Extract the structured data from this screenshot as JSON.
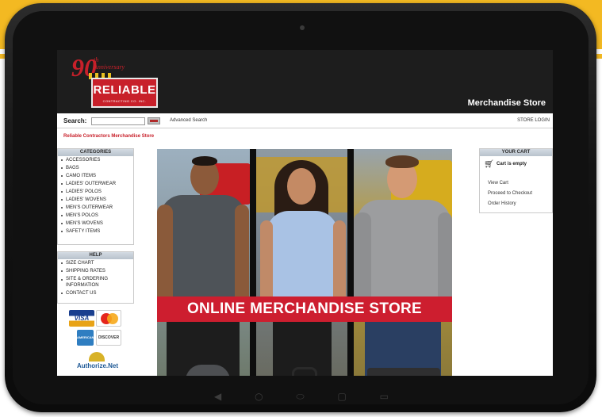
{
  "header": {
    "logo_90": "90",
    "logo_anniversary": "th Anniversary",
    "logo_brand": "RELIABLE",
    "logo_subtitle": "CONTRACTING CO. INC.",
    "store_title": "Merchandise Store"
  },
  "search": {
    "label": "Search:",
    "value": "",
    "placeholder": "",
    "advanced_label": "Advanced Search",
    "store_login_label": "STORE LOGIN"
  },
  "breadcrumb": "Reliable Contractors Merchandise Store",
  "categories": {
    "title": "CATEGORIES",
    "items": [
      "ACCESSORIES",
      "BAGS",
      "CAMO ITEMS",
      "LADIES' OUTERWEAR",
      "LADIES' POLOS",
      "LADIES' WOVENS",
      "MEN'S OUTERWEAR",
      "MEN'S POLOS",
      "MEN'S WOVENS",
      "SAFETY ITEMS"
    ]
  },
  "help": {
    "title": "HELP",
    "items": [
      "SIZE CHART",
      "SHIPPING RATES",
      "SITE & ORDERING INFORMATION",
      "CONTACT US"
    ]
  },
  "payment": {
    "visa": "VISA",
    "mastercard": "MasterCard",
    "amex": "AMERICAN EXPRESS",
    "discover": "DISCOVER",
    "authorize_net": "Authorize.Net"
  },
  "cart": {
    "title": "YOUR CART",
    "status": "Cart is empty",
    "links": [
      "View Cart",
      "Proceed to Checkout",
      "Order History"
    ]
  },
  "banner": {
    "text": "ONLINE MERCHANDISE STORE"
  },
  "colors": {
    "brand_red": "#c8202a",
    "header_black": "#1d1d1d",
    "gold": "#f3b922",
    "banner_red": "#cd1e2f"
  },
  "icons": {
    "cart": "shopping-cart-icon",
    "search_go": "search-go-icon"
  }
}
